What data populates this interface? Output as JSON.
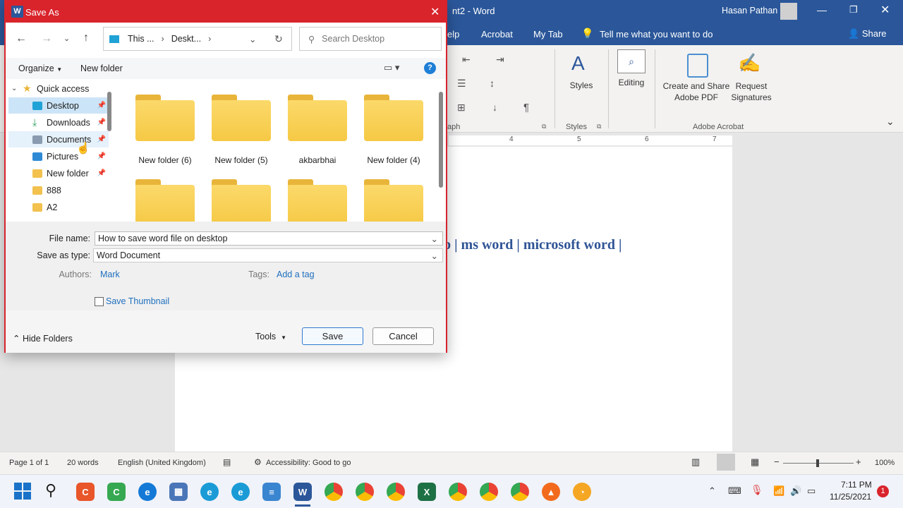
{
  "word": {
    "title": "nt2 - Word",
    "user": "Hasan Pathan",
    "tabs": [
      "elp",
      "Acrobat",
      "My Tab"
    ],
    "tell_me": "Tell me what you want to do",
    "share": "Share",
    "ribbon": {
      "styles": "Styles",
      "editing": "Editing",
      "create_share": "Create and Share Adobe PDF",
      "request_signatures": "Request Signatures",
      "group_paragraph": "aph",
      "group_styles": "Styles",
      "group_acrobat": "Adobe Acrobat"
    },
    "ruler": [
      "4",
      "5",
      "6",
      "7"
    ],
    "doc_text": "p | ms word | microsoft word |",
    "status": {
      "page": "Page 1 of 1",
      "words": "20 words",
      "language": "English (United Kingdom)",
      "accessibility": "Accessibility: Good to go",
      "zoom": "100%"
    }
  },
  "dialog": {
    "title": "Save As",
    "breadcrumb": [
      "This ...",
      "Deskt..."
    ],
    "search_placeholder": "Search Desktop",
    "organize": "Organize",
    "new_folder": "New folder",
    "nav": [
      {
        "label": "Quick access",
        "icon": "star-icon",
        "color": "#e8b53a"
      },
      {
        "label": "Desktop",
        "icon": "desktop-icon",
        "color": "#1fa2d6"
      },
      {
        "label": "Downloads",
        "icon": "download-icon",
        "color": "#2c9f5e"
      },
      {
        "label": "Documents",
        "icon": "document-icon",
        "color": "#8a9bb0"
      },
      {
        "label": "Pictures",
        "icon": "picture-icon",
        "color": "#2f8ad6"
      },
      {
        "label": "New folder",
        "icon": "folder-icon",
        "color": "#f2c14e"
      },
      {
        "label": "888",
        "icon": "folder-icon",
        "color": "#f2c14e"
      },
      {
        "label": "A2",
        "icon": "folder-icon",
        "color": "#f2c14e"
      }
    ],
    "folders": [
      "New folder (6)",
      "New folder (5)",
      "akbarbhai",
      "New folder (4)"
    ],
    "file_name_label": "File name:",
    "file_name": "How to save word file on desktop",
    "save_type_label": "Save as type:",
    "save_type": "Word Document",
    "authors_label": "Authors:",
    "authors": "Mark",
    "tags_label": "Tags:",
    "tags": "Add a tag",
    "save_thumbnail": "Save Thumbnail",
    "hide_folders": "Hide Folders",
    "tools": "Tools",
    "save": "Save",
    "cancel": "Cancel"
  },
  "taskbar": {
    "time": "7:11 PM",
    "date": "11/25/2021",
    "notifications": "1"
  }
}
